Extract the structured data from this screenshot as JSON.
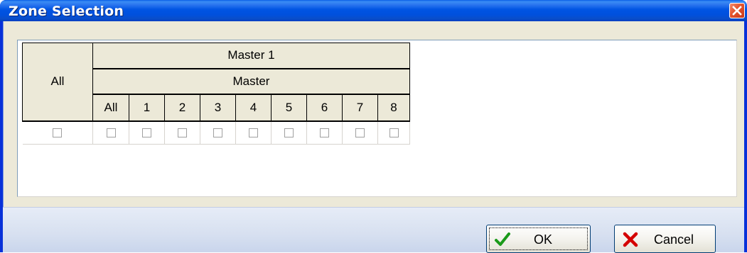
{
  "window": {
    "title": "Zone Selection"
  },
  "grid": {
    "all_header": "All",
    "group_header": "Master 1",
    "sub_header": "Master",
    "columns": [
      "All",
      "1",
      "2",
      "3",
      "4",
      "5",
      "6",
      "7",
      "8"
    ],
    "all_checked": false,
    "checked": [
      false,
      false,
      false,
      false,
      false,
      false,
      false,
      false,
      false
    ]
  },
  "buttons": {
    "ok_label": "OK",
    "cancel_label": "Cancel"
  },
  "icons": {
    "ok": "checkmark-icon",
    "cancel": "x-icon",
    "close": "close-icon"
  },
  "colors": {
    "titlebar": "#0054e3",
    "ok_check": "#1a9a1a",
    "cancel_x": "#d40000"
  }
}
